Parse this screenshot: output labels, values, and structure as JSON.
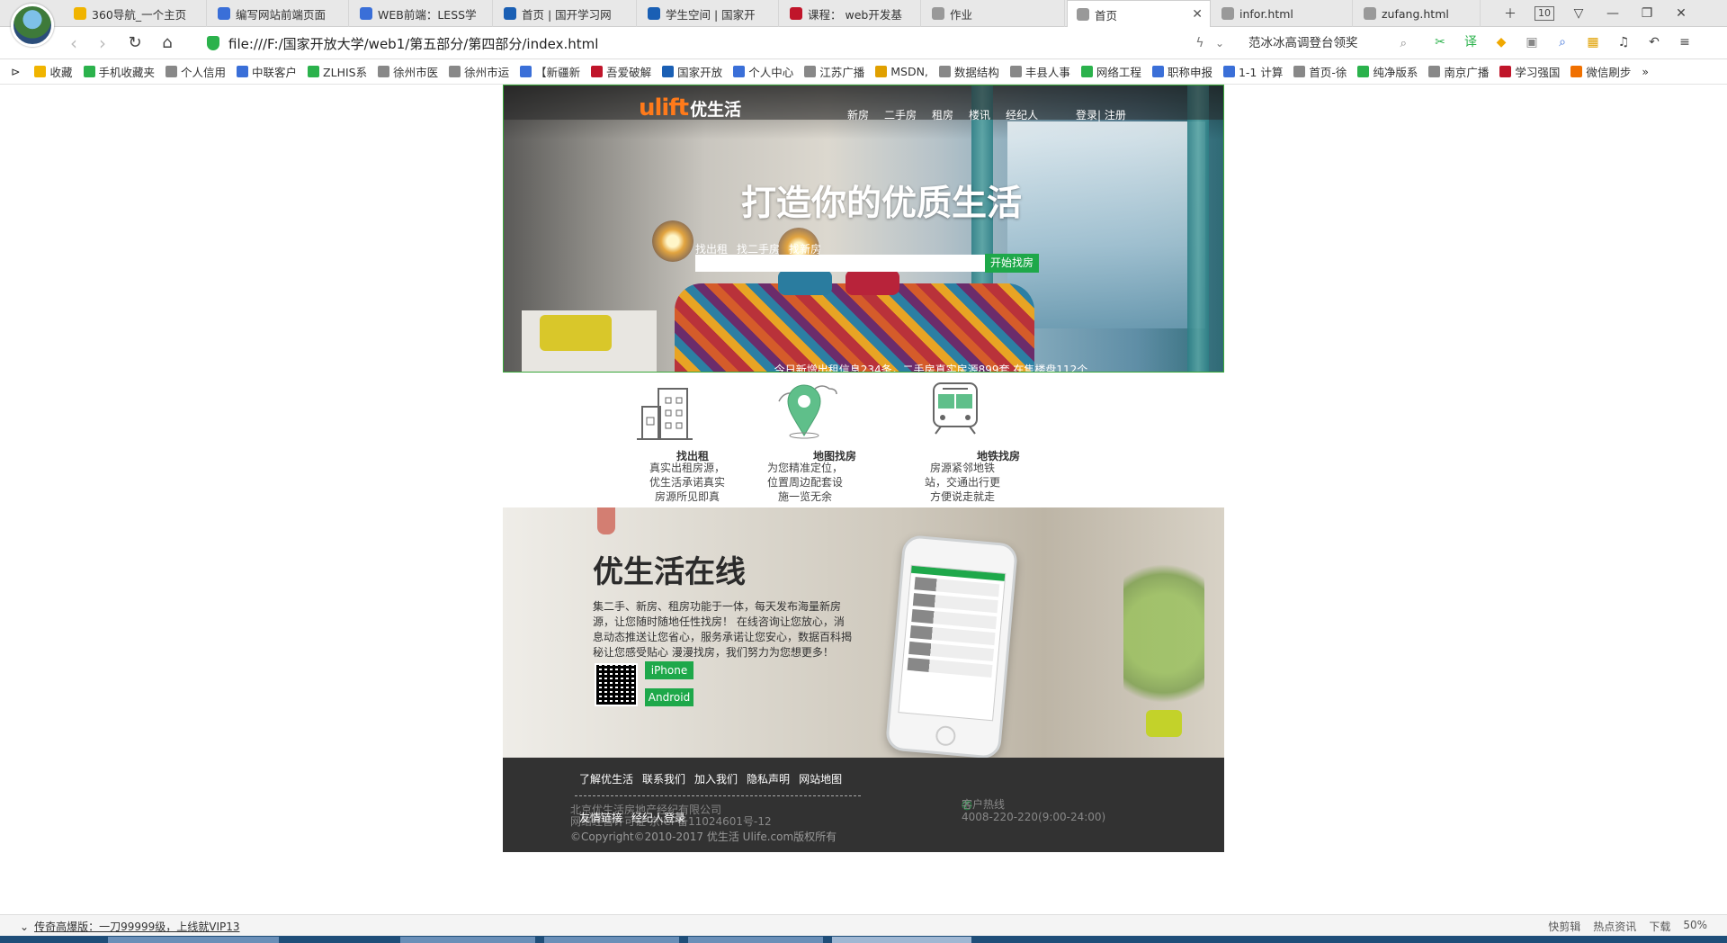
{
  "browser": {
    "tabs": [
      {
        "label": "360导航_一个主页",
        "color": "#f0b400"
      },
      {
        "label": "编写网站前端页面",
        "color": "#3a6fd8"
      },
      {
        "label": "WEB前端：LESS学",
        "color": "#3a6fd8"
      },
      {
        "label": "首页 | 国开学习网",
        "color": "#1a5fb4"
      },
      {
        "label": "学生空间 | 国家开",
        "color": "#1a5fb4"
      },
      {
        "label": "课程： web开发基",
        "color": "#c0152a"
      },
      {
        "label": "作业",
        "color": "#999999"
      },
      {
        "label": "首页",
        "color": "#999999",
        "active": true
      },
      {
        "label": "infor.html",
        "color": "#999999"
      },
      {
        "label": "zufang.html",
        "color": "#999999"
      }
    ],
    "tab_count": "10",
    "url": "file:///F:/国家开放大学/web1/第五部分/第四部分/index.html",
    "search_text": "范冰冰高调登台领奖",
    "bookmarks": [
      "收藏",
      "手机收藏夹",
      "个人信用",
      "中联客户",
      "ZLHIS系",
      "徐州市医",
      "徐州市运",
      "【新疆新",
      "吾爱破解",
      "国家开放",
      "个人中心",
      "江苏广播",
      "MSDN,",
      "数据结构",
      "丰县人事",
      "网络工程",
      "职称申报",
      "1-1 计算",
      "首页-徐",
      "纯净版系",
      "南京广播",
      "学习强国",
      "微信刷步"
    ]
  },
  "site": {
    "logo_en": "ulift",
    "logo_cn": "优生活",
    "nav": [
      "新房",
      "二手房",
      "租房",
      "楼讯",
      "经纪人"
    ],
    "login": "登录|",
    "register": "注册",
    "hero_title": "打造你的优质生活",
    "search_tabs": [
      "找出租",
      "找二手房",
      "找新房"
    ],
    "search_placeholder": "",
    "search_button": "开始找房",
    "stats": "今日新增出租信息234条，二手房真实房源899套 在售楼盘112个"
  },
  "features": [
    {
      "title": "找出租",
      "desc": "真实出租房源，优生活承诺真实房源所见即真",
      "icon": "building-icon"
    },
    {
      "title": "地图找房",
      "desc": "为您精准定位，位置周边配套设施一览无余",
      "icon": "map-pin-icon"
    },
    {
      "title": "地铁找房",
      "desc": "房源紧邻地铁站，交通出行更方便说走就走",
      "icon": "subway-icon"
    }
  ],
  "promo": {
    "title": "优生活在线",
    "desc": "集二手、新房、租房功能于一体，每天发布海量新房源，让您随时随地任性找房！ 在线咨询让您放心，消息动态推送让您省心，服务承诺让您安心，数据百科揭秘让您感受贴心 漫漫找房，我们努力为您想更多！",
    "iphone": "iPhone",
    "android": "Android"
  },
  "footer": {
    "links": [
      "了解优生活",
      "联系我们",
      "加入我们",
      "隐私声明",
      "网站地图"
    ],
    "links2": [
      "友情链接",
      "经纪人登录"
    ],
    "company": "北京优生活房地产经纪有限公司",
    "icp": "网络经营许可证 京ICP备11024601号-12",
    "copyright": "©Copyright©2010-2017 优生活 Ulife.com版权所有",
    "hotline_label": "客户热线",
    "hotline": "4008-220-220(9:00-24:00)"
  },
  "status": {
    "news": "传奇高爆版：一刀99999级，上线就VIP13",
    "items": [
      "快剪辑",
      "热点资讯",
      "下载",
      "50%"
    ]
  }
}
